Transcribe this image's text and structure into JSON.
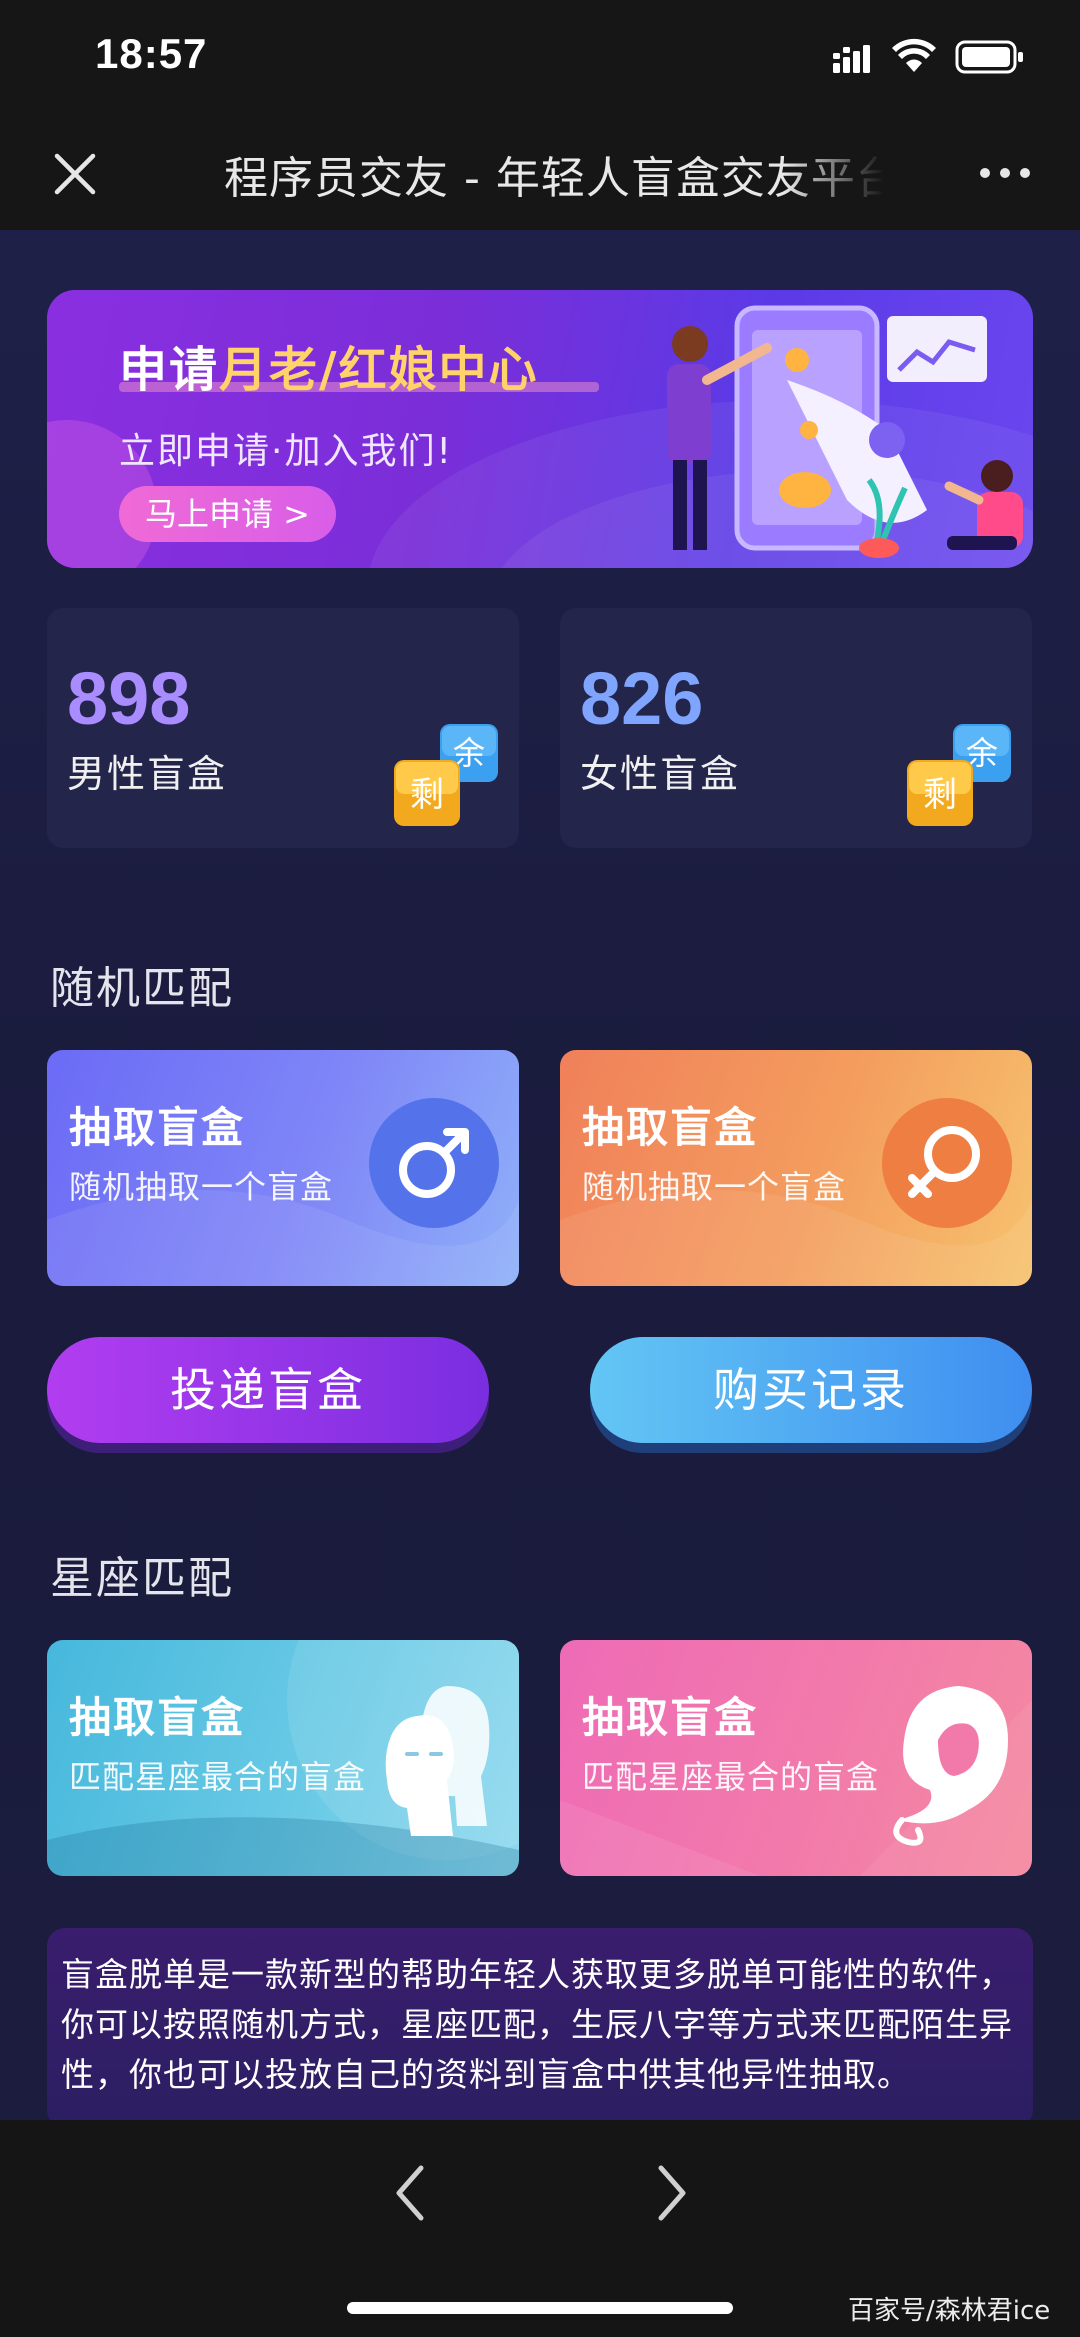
{
  "status_bar": {
    "time": "18:57"
  },
  "nav": {
    "title": "程序员交友 - 年轻人盲盒交友平台"
  },
  "banner": {
    "title_prefix": "申请",
    "title_highlight": "月老/红娘中心",
    "subtitle": "立即申请·加入我们!",
    "button_label": "马上申请 >"
  },
  "stats": [
    {
      "count": "898",
      "label": "男性盲盒",
      "badge_top": "余",
      "badge_bottom": "剩",
      "color": "#a98cff"
    },
    {
      "count": "826",
      "label": "女性盲盒",
      "badge_top": "余",
      "badge_bottom": "剩",
      "color": "#7fa5ff"
    }
  ],
  "random_match": {
    "section_title": "随机匹配",
    "cards": [
      {
        "title": "抽取盲盒",
        "subtitle": "随机抽取一个盲盒",
        "icon": "male-symbol-icon"
      },
      {
        "title": "抽取盲盒",
        "subtitle": "随机抽取一个盲盒",
        "icon": "female-symbol-icon"
      }
    ]
  },
  "actions": {
    "deliver": "投递盲盒",
    "records": "购买记录"
  },
  "zodiac_match": {
    "section_title": "星座匹配",
    "cards": [
      {
        "title": "抽取盲盒",
        "subtitle": "匹配星座最合的盲盒",
        "icon": "gemini-icon"
      },
      {
        "title": "抽取盲盒",
        "subtitle": "匹配星座最合的盲盒",
        "icon": "virgo-icon"
      }
    ]
  },
  "description": "盲盒脱单是一款新型的帮助年轻人获取更多脱单可能性的软件，你可以按照随机方式，星座匹配，生辰八字等方式来匹配陌生异性，你也可以投放自己的资料到盲盒中供其他异性抽取。",
  "watermark": "百家号/森林君ice"
}
